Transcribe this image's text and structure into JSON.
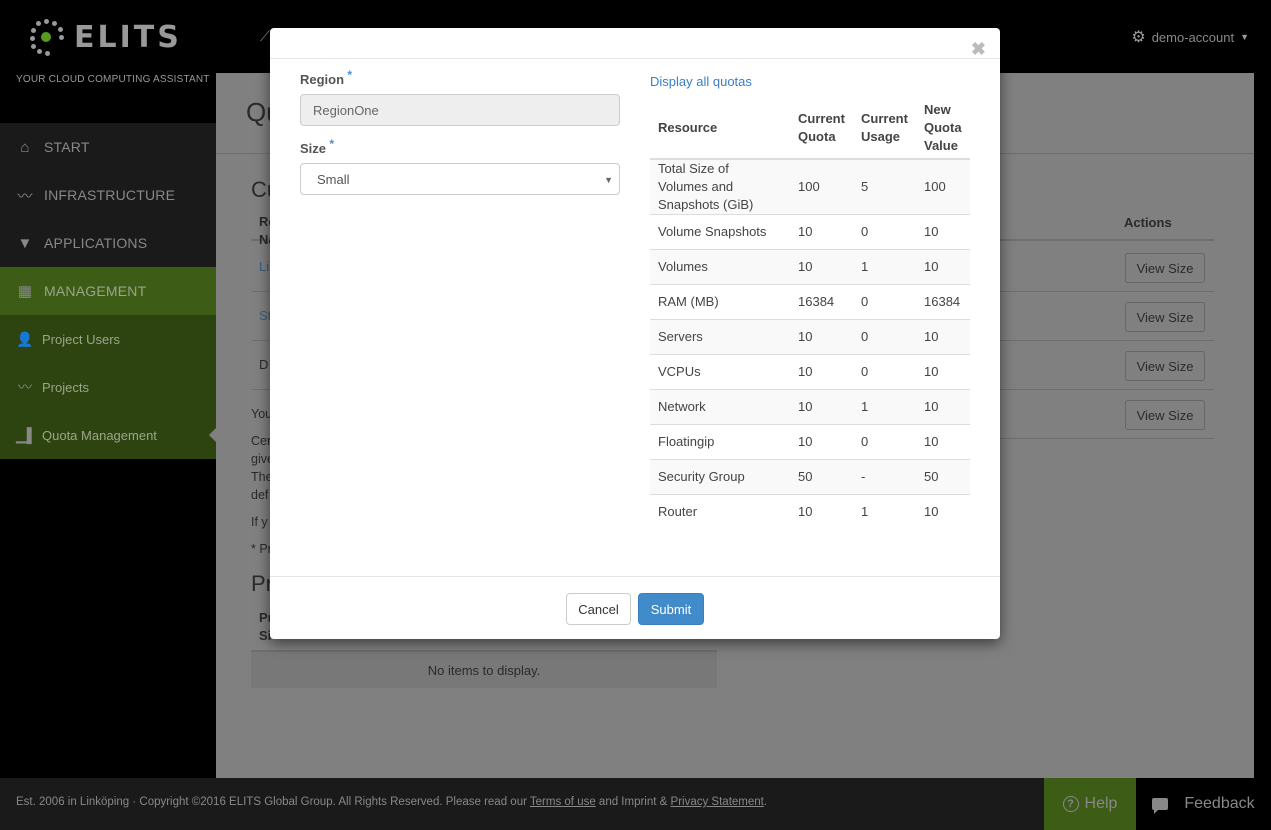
{
  "brand": {
    "logo_text": "ELITS",
    "tagline": "YOUR CLOUD COMPUTING ASSISTANT",
    "accent_color": "#5a9a1f"
  },
  "header": {
    "account_label": "demo-account",
    "account_icon": "gear-icon"
  },
  "sidebar": {
    "items": [
      {
        "label": "START",
        "icon": "home-icon"
      },
      {
        "label": "INFRASTRUCTURE",
        "icon": "line-chart-icon"
      },
      {
        "label": "APPLICATIONS",
        "icon": "applications-icon"
      },
      {
        "label": "MANAGEMENT",
        "icon": "calendar-icon",
        "active": true
      }
    ],
    "sub_items": [
      {
        "label": "Project Users",
        "icon": "user-gear-icon"
      },
      {
        "label": "Projects",
        "icon": "line-chart-icon"
      },
      {
        "label": "Quota Management",
        "icon": "bar-chart-icon",
        "current": true
      }
    ]
  },
  "background_page": {
    "title_partial": "Qu",
    "section_partial": "Cu",
    "table_head_partial": "Re\nNa",
    "actions_header": "Actions",
    "rows": [
      {
        "name_partial": "Li",
        "link": true,
        "action": "View Size"
      },
      {
        "name_partial": "St",
        "link": true,
        "action": "View Size"
      },
      {
        "name_partial": "D",
        "link": false,
        "action": "View Size"
      },
      {
        "name_partial": "",
        "link": false,
        "action": "View Size"
      }
    ],
    "text_partials": [
      "You",
      "Cer",
      "give",
      "The",
      "def",
      "If y",
      "* Pr"
    ],
    "section2_partial": "Pr",
    "table2_head_partial": "Pr\nSi",
    "empty_message": "No items to display."
  },
  "modal": {
    "close_icon": "close-icon",
    "region": {
      "label": "Region",
      "required_mark": "*",
      "value": "RegionOne"
    },
    "size": {
      "label": "Size",
      "required_mark": "*",
      "selected": "Small"
    },
    "display_all_link": "Display all quotas",
    "quota_table": {
      "headers": [
        "Resource",
        "Current Quota",
        "Current Usage",
        "New Quota Value"
      ],
      "rows": [
        {
          "resource": "Total Size of Volumes and Snapshots (GiB)",
          "current_quota": "100",
          "current_usage": "5",
          "new_quota": "100"
        },
        {
          "resource": "Volume Snapshots",
          "current_quota": "10",
          "current_usage": "0",
          "new_quota": "10"
        },
        {
          "resource": "Volumes",
          "current_quota": "10",
          "current_usage": "1",
          "new_quota": "10"
        },
        {
          "resource": "RAM (MB)",
          "current_quota": "16384",
          "current_usage": "0",
          "new_quota": "16384"
        },
        {
          "resource": "Servers",
          "current_quota": "10",
          "current_usage": "0",
          "new_quota": "10"
        },
        {
          "resource": "VCPUs",
          "current_quota": "10",
          "current_usage": "0",
          "new_quota": "10"
        },
        {
          "resource": "Network",
          "current_quota": "10",
          "current_usage": "1",
          "new_quota": "10"
        },
        {
          "resource": "Floatingip",
          "current_quota": "10",
          "current_usage": "0",
          "new_quota": "10"
        },
        {
          "resource": "Security Group",
          "current_quota": "50",
          "current_usage": "-",
          "new_quota": "50"
        },
        {
          "resource": "Router",
          "current_quota": "10",
          "current_usage": "1",
          "new_quota": "10"
        }
      ]
    },
    "cancel_label": "Cancel",
    "submit_label": "Submit",
    "submit_color": "#428bca"
  },
  "footer": {
    "text_before": "Est. 2006 in Linköping · Copyright ©2016 ELITS Global Group. All Rights Reserved. Please read our ",
    "terms_link": "Terms of use",
    "text_middle": " and Imprint & ",
    "privacy_link": "Privacy Statement",
    "text_after": ".",
    "help_label": "Help",
    "feedback_label": "Feedback"
  }
}
